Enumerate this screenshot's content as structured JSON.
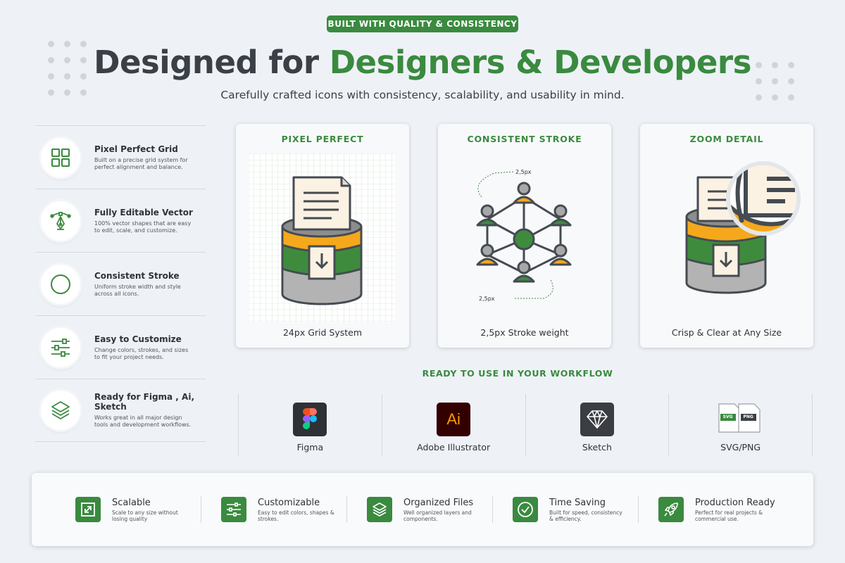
{
  "badge": "BUILT WITH QUALITY & CONSISTENCY",
  "title": {
    "part1": "Designed for ",
    "part2": "Designers & Developers"
  },
  "subtitle": "Carefully crafted icons with consistency, scalability, and usability in mind.",
  "features": [
    {
      "title": "Pixel Perfect Grid",
      "desc": "Built on a precise grid system for perfect alignment and balance.",
      "icon": "grid-icon"
    },
    {
      "title": "Fully Editable Vector",
      "desc": "100% vector shapes that are easy to edit, scale, and customize.",
      "icon": "pen-tool-icon"
    },
    {
      "title": "Consistent Stroke",
      "desc": "Uniform stroke width and style across all icons.",
      "icon": "circle-icon"
    },
    {
      "title": "Easy to Customize",
      "desc": "Change colors, strokes, and sizes to fit your project needs.",
      "icon": "sliders-icon"
    },
    {
      "title": "Ready for Figma , Ai, Sketch",
      "desc": "Works great in all major design tools and development workflows.",
      "icon": "layers-icon"
    }
  ],
  "cards": [
    {
      "title": "PIXEL PERFECT",
      "caption": "24px Grid System"
    },
    {
      "title": "CONSISTENT STROKE",
      "caption": "2,5px Stroke weight",
      "annotation_top": "2,5px",
      "annotation_bottom": "2,5px"
    },
    {
      "title": "ZOOM DETAIL",
      "caption": "Crisp & Clear at Any Size"
    }
  ],
  "workflow_title": "READY TO USE IN YOUR WORKFLOW",
  "tools": [
    {
      "label": "Figma",
      "icon": "figma-icon"
    },
    {
      "label": "Adobe Illustrator",
      "icon": "illustrator-icon",
      "glyph": "Ai"
    },
    {
      "label": "Sketch",
      "icon": "sketch-icon"
    },
    {
      "label": "SVG/PNG",
      "icon": "file-format-icon",
      "tag1": "SVG",
      "tag2": "PNG"
    }
  ],
  "benefits": [
    {
      "title": "Scalable",
      "desc": "Scale to any size without losing quality",
      "icon": "resize-icon"
    },
    {
      "title": "Customizable",
      "desc": "Easy to edit colors, shapes & strokes.",
      "icon": "sliders-icon"
    },
    {
      "title": "Organized Files",
      "desc": "Well organized layers and components.",
      "icon": "layers-icon"
    },
    {
      "title": "Time Saving",
      "desc": "Built for speed, consistency & efficiency.",
      "icon": "check-circle-icon"
    },
    {
      "title": "Production Ready",
      "desc": "Perfect for real projects & commercial use.",
      "icon": "rocket-icon"
    }
  ],
  "colors": {
    "accent": "#3a8a3f",
    "orange": "#f5a81b",
    "dark": "#3b3f46"
  }
}
